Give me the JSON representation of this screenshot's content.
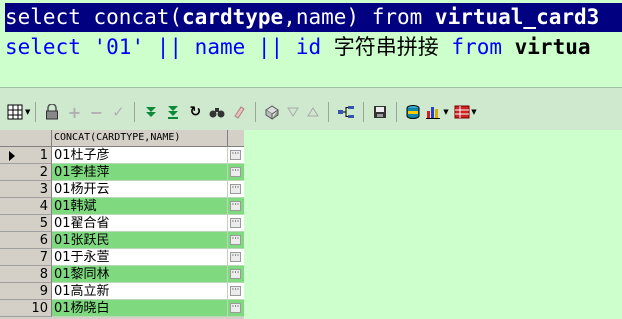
{
  "editor": {
    "line1": {
      "select": "select ",
      "concat_expr": "concat(",
      "arg1": "cardtype",
      "comma_name": ",name) ",
      "from": "from ",
      "table": "virtual_card3"
    },
    "line2": {
      "select": "select ",
      "literal": "'01'",
      "op1": " || ",
      "name": "name",
      "op2": " || ",
      "id": "id",
      "alias": " 字符串拼接 ",
      "from": "from ",
      "table": "virtua"
    }
  },
  "toolbar": {
    "items": [
      "grid-menu-icon",
      "lock-icon",
      "add-record-icon",
      "remove-record-icon",
      "post-icon",
      "fetch-next-icon",
      "fetch-last-icon",
      "refresh-icon",
      "find-icon",
      "clear-icon",
      "query-icon",
      "filter-down-icon",
      "filter-up-icon",
      "tree-icon",
      "save-icon",
      "export-icon",
      "chart-icon",
      "table-icon"
    ]
  },
  "grid": {
    "column_header": "CONCAT(CARDTYPE,NAME)",
    "rows": [
      {
        "num": "1",
        "value": "01杜子彦"
      },
      {
        "num": "2",
        "value": "01李桂萍"
      },
      {
        "num": "3",
        "value": "01杨开云"
      },
      {
        "num": "4",
        "value": "01韩斌"
      },
      {
        "num": "5",
        "value": "01翟合省"
      },
      {
        "num": "6",
        "value": "01张跃民"
      },
      {
        "num": "7",
        "value": "01于永萱"
      },
      {
        "num": "8",
        "value": "01黎同林"
      },
      {
        "num": "9",
        "value": "01高立新"
      },
      {
        "num": "10",
        "value": "01杨晓白"
      }
    ],
    "ellipsis": "···"
  },
  "colors": {
    "editor_bg": "#ccffcc",
    "selection_bg": "#000080",
    "keyword": "#0000ff",
    "row_alt": "#7fd97f"
  }
}
